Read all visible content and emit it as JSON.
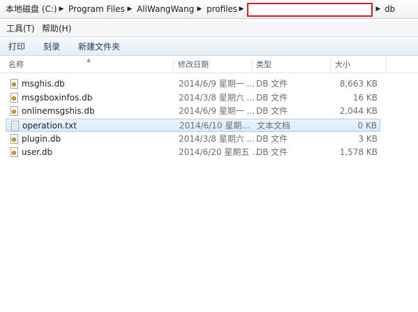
{
  "breadcrumb": {
    "items": [
      "本地磁盘 (C:)",
      "Program Files",
      "AliWangWang",
      "profiles",
      "db"
    ]
  },
  "menu": {
    "items": [
      "工具(T)",
      "帮助(H)"
    ]
  },
  "toolbar": {
    "buttons": [
      "打印",
      "刻录",
      "新建文件夹"
    ]
  },
  "columns": {
    "name": "名称",
    "date": "修改日期",
    "type": "类型",
    "size": "大小"
  },
  "files": [
    {
      "name": "msghis.db",
      "date": "2014/6/9 星期一 ...",
      "type": "DB 文件",
      "size": "8,663 KB",
      "icon": "db-file-icon"
    },
    {
      "name": "msgsboxinfos.db",
      "date": "2014/3/8 星期六 ...",
      "type": "DB 文件",
      "size": "16 KB",
      "icon": "db-file-icon"
    },
    {
      "name": "onlinemsgshis.db",
      "date": "2014/6/9 星期一 ...",
      "type": "DB 文件",
      "size": "2,044 KB",
      "icon": "db-file-icon"
    },
    {
      "name": "operation.txt",
      "date": "2014/6/10 星期...",
      "type": "文本文档",
      "size": "0 KB",
      "icon": "text-file-icon"
    },
    {
      "name": "plugin.db",
      "date": "2014/3/8 星期六 ...",
      "type": "DB 文件",
      "size": "3 KB",
      "icon": "db-file-icon"
    },
    {
      "name": "user.db",
      "date": "2014/6/20 星期五 ...",
      "type": "DB 文件",
      "size": "1,578 KB",
      "icon": "db-file-icon"
    }
  ],
  "colors": {
    "highlight_border": "#e0161e",
    "selection": "#d9e9fa"
  }
}
